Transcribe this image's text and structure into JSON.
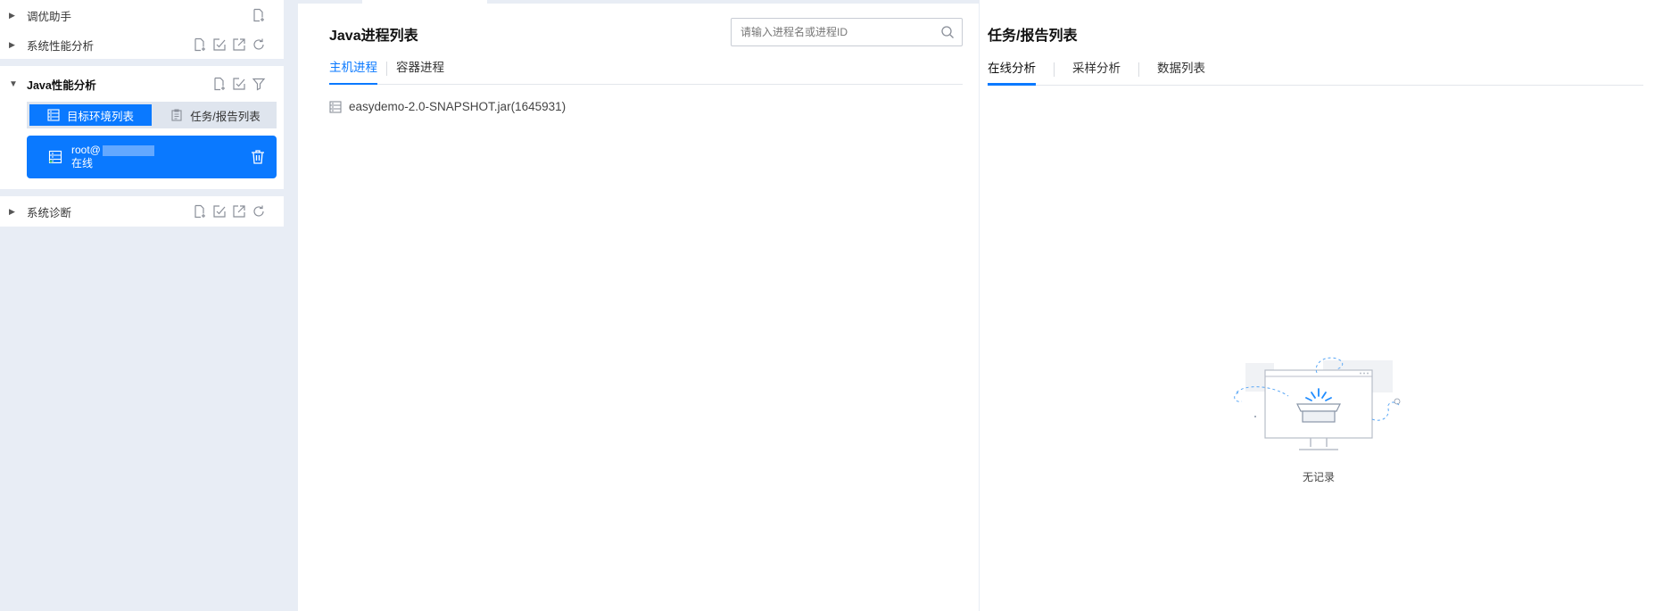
{
  "sidebar": {
    "tuning_assistant": {
      "label": "调优助手"
    },
    "system_perf": {
      "label": "系统性能分析"
    },
    "java_perf": {
      "label": "Java性能分析",
      "seg_targets": "目标环境列表",
      "seg_tasks": "任务/报告列表",
      "env": {
        "host": "root@",
        "status": "在线"
      }
    },
    "system_diag": {
      "label": "系统诊断"
    }
  },
  "middle": {
    "title": "Java进程列表",
    "search_placeholder": "请输入进程名或进程ID",
    "tabs": [
      "主机进程",
      "容器进程"
    ],
    "processes": [
      "easydemo-2.0-SNAPSHOT.jar(1645931)"
    ]
  },
  "right": {
    "title": "任务/报告列表",
    "tabs": [
      "在线分析",
      "采样分析",
      "数据列表"
    ],
    "empty_text": "无记录"
  },
  "colors": {
    "accent": "#0a79ff",
    "sidebar_bg": "#e8edf5"
  },
  "icons": [
    "add-file-icon",
    "import-icon",
    "export-icon",
    "refresh-icon",
    "filter-icon",
    "server-icon",
    "clipboard-icon",
    "trash-icon",
    "search-icon",
    "empty-box-illustration"
  ]
}
